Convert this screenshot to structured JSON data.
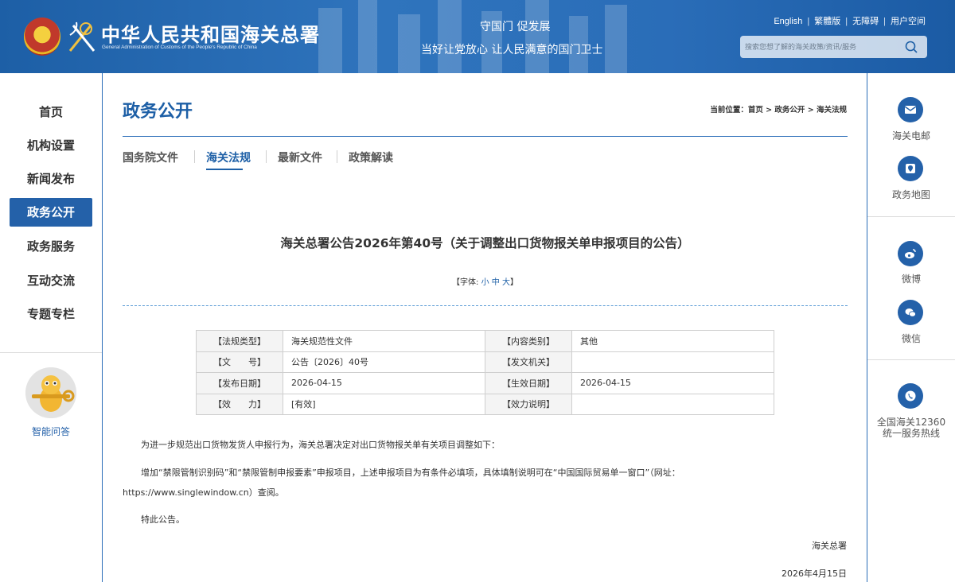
{
  "header": {
    "logo_cn": "中华人民共和国海关总署",
    "logo_en": "General Administration of Customs of the People's Republic of China",
    "slogan_line1": "守国门  促发展",
    "slogan_line2": "当好让党放心  让人民满意的国门卫士",
    "links": [
      "English",
      "繁體版",
      "无障碍",
      "用户空间"
    ],
    "search_placeholder": "搜索您想了解的海关政策/资讯/服务"
  },
  "leftnav": {
    "items": [
      {
        "label": "首页"
      },
      {
        "label": "机构设置"
      },
      {
        "label": "新闻发布"
      },
      {
        "label": "政务公开",
        "active": true
      },
      {
        "label": "政务服务"
      },
      {
        "label": "互动交流"
      },
      {
        "label": "专题专栏"
      }
    ],
    "assistant_label": "智能问答"
  },
  "main": {
    "page_title": "政务公开",
    "breadcrumb": "当前位置：首页 > 政务公开 > 海关法规",
    "tabs": [
      {
        "label": "国务院文件"
      },
      {
        "label": "海关法规",
        "active": true
      },
      {
        "label": "最新文件"
      },
      {
        "label": "政策解读"
      }
    ],
    "doc_title": "海关总署公告2026年第40号（关于调整出口货物报关单申报项目的公告）",
    "font_size": {
      "prefix": "【字体: ",
      "small": "小",
      "medium": "中",
      "large": "大",
      "suffix": "】"
    },
    "meta": [
      {
        "k1": "【法规类型】",
        "v1": "海关规范性文件",
        "k2": "【内容类别】",
        "v2": "其他"
      },
      {
        "k1": "【文　　号】",
        "v1": "公告〔2026〕40号",
        "k2": "【发文机关】",
        "v2": ""
      },
      {
        "k1": "【发布日期】",
        "v1": "2026-04-15",
        "k2": "【生效日期】",
        "v2": "2026-04-15"
      },
      {
        "k1": "【效　　力】",
        "v1": "[有效]",
        "k2": "【效力说明】",
        "v2": ""
      }
    ],
    "paragraphs": [
      "为进一步规范出口货物发货人申报行为，海关总署决定对出口货物报关单有关项目调整如下：",
      "增加“禁限管制识别码”和“禁限管制申报要素”申报项目，上述申报项目为有条件必填项，具体填制说明可在“中国国际贸易单一窗口”（网址：",
      "https://www.singlewindow.cn）查阅。",
      "特此公告。"
    ],
    "signature": "海关总署",
    "date": "2026年4月15日"
  },
  "rightrail": {
    "items": [
      {
        "label": "海关电邮",
        "icon": "mail-icon"
      },
      {
        "label": "政务地图",
        "icon": "map-icon"
      },
      {
        "label": "微博",
        "icon": "weibo-icon"
      },
      {
        "label": "微信",
        "icon": "wechat-icon"
      },
      {
        "label": "全国海关12360统一服务热线",
        "line1": "全国海关12360",
        "line2": "统一服务热线",
        "icon": "phone-icon"
      }
    ]
  },
  "colors": {
    "brand_blue": "#1d5fa6",
    "nav_active": "#2461a9"
  }
}
